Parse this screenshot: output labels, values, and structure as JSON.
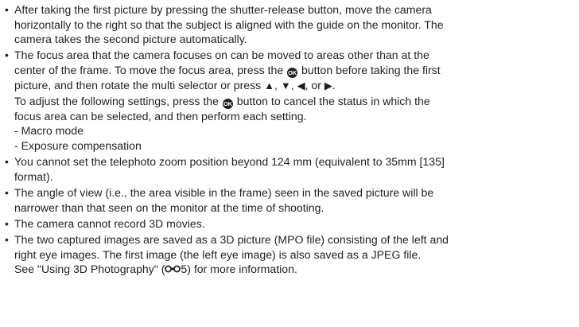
{
  "ok_button_text": "OK",
  "icons": {
    "ok": "ok-button-icon",
    "arrows": [
      "up-arrow-icon",
      "down-arrow-icon",
      "left-arrow-icon",
      "right-arrow-icon"
    ],
    "reference": "reference-section-icon"
  },
  "b1": [
    "After taking the first picture by pressing the shutter-release button, move the camera",
    "horizontally to the right so that the subject is aligned with the guide on the monitor. The",
    "camera takes the second picture automatically."
  ],
  "b2": {
    "l1": "The focus area that the camera focuses on can be moved to areas other than at the",
    "l2a": "center of the frame. To move the focus area, press the ",
    "l2b": " button before taking the first",
    "l3a": "picture, and then rotate the multi selector or press ",
    "up": "▲",
    "down": "▼",
    "left": "◀",
    "right": "▶",
    "sep1": ", ",
    "sep2": ", ",
    "sep3": ", or ",
    "end": ".",
    "l4a": "To adjust the following settings, press the ",
    "l4b": " button to cancel the status in which the",
    "l5": "focus area can be selected, and then perform each setting.",
    "sub1": "-  Macro mode",
    "sub2": "-  Exposure compensation"
  },
  "b3": [
    "You cannot set the telephoto zoom position beyond 124 mm (equivalent to 35mm [135]",
    "format)."
  ],
  "b4": [
    "The angle of view (i.e., the area visible in the frame) seen in the saved picture will be",
    "narrower than that seen on the monitor at the time of shooting."
  ],
  "b5": "The camera cannot record 3D movies.",
  "b6": {
    "l1": "The two captured images are saved as a 3D picture (MPO file) consisting of the left and",
    "l2": "right eye images. The first image (the left eye image) is also saved as a JPEG file.",
    "l3a": "See \"Using 3D Photography\" (",
    "ref_page": "5",
    "l3b": ") for more information."
  }
}
